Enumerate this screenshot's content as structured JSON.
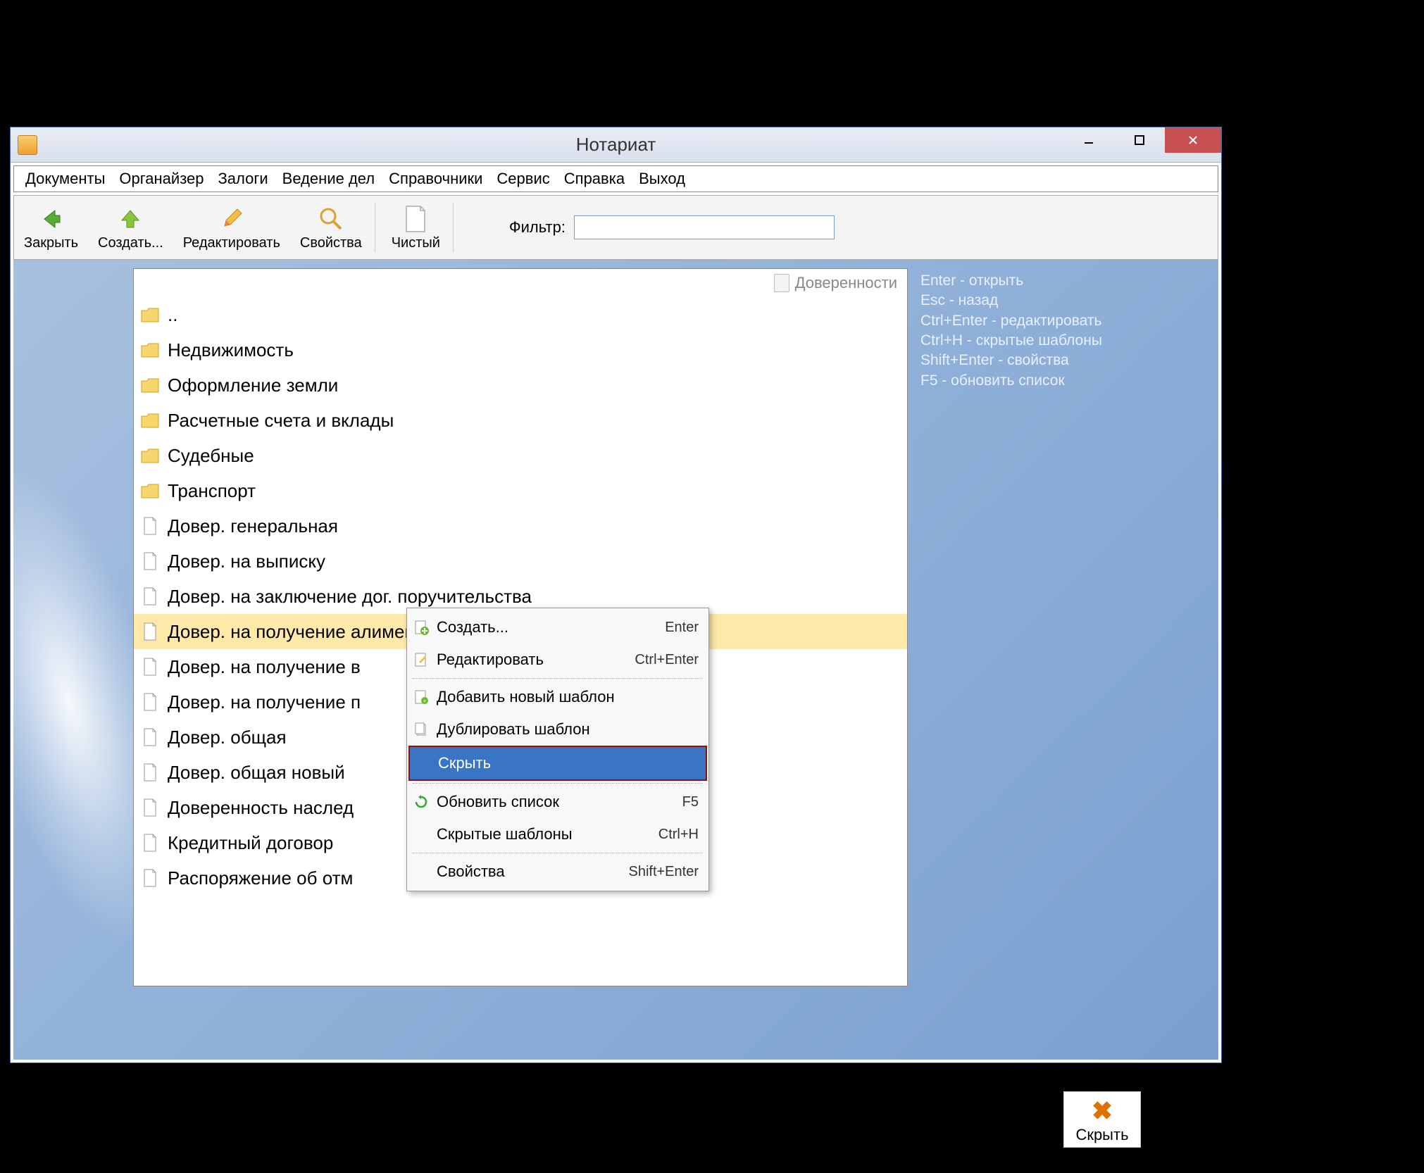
{
  "window": {
    "title": "Нотариат"
  },
  "menubar": [
    "Документы",
    "Органайзер",
    "Залоги",
    "Ведение дел",
    "Справочники",
    "Сервис",
    "Справка",
    "Выход"
  ],
  "toolbar": {
    "close": "Закрыть",
    "create": "Создать...",
    "edit": "Редактировать",
    "properties": "Свойства",
    "clean": "Чистый",
    "filter_label": "Фильтр:",
    "filter_value": ""
  },
  "breadcrumb": "Доверенности",
  "list": {
    "up": "..",
    "folders": [
      "Недвижимость",
      "Оформление земли",
      "Расчетные счета и вклады",
      "Судебные",
      "Транспорт"
    ],
    "docs": [
      "Довер. генеральная",
      "Довер. на выписку",
      "Довер. на заключение дог. поручительства",
      "Довер. на получение алиментов",
      "Довер. на получение в",
      "Довер. на получение п",
      "Довер. общая",
      "Довер. общая новый",
      "Доверенность наслед",
      "Кредитный договор",
      "Распоряжение об отм"
    ],
    "selected_index": 3
  },
  "hints": [
    "Enter - открыть",
    "Esc - назад",
    "Ctrl+Enter - редактировать",
    "Ctrl+H - скрытые шаблоны",
    "Shift+Enter - свойства",
    "F5 - обновить список"
  ],
  "context_menu": {
    "items": [
      {
        "label": "Создать...",
        "shortcut": "Enter",
        "icon": "plus"
      },
      {
        "label": "Редактировать",
        "shortcut": "Ctrl+Enter",
        "icon": "edit"
      },
      {
        "sep": true
      },
      {
        "label": "Добавить новый шаблон",
        "shortcut": "",
        "icon": "add-doc"
      },
      {
        "label": "Дублировать шаблон",
        "shortcut": "",
        "icon": "dup-doc"
      },
      {
        "label": "Скрыть",
        "shortcut": "",
        "icon": "",
        "highlighted": true
      },
      {
        "sep": true
      },
      {
        "label": "Обновить список",
        "shortcut": "F5",
        "icon": "refresh"
      },
      {
        "label": "Скрытые шаблоны",
        "shortcut": "Ctrl+H",
        "icon": ""
      },
      {
        "sep": true
      },
      {
        "label": "Свойства",
        "shortcut": "Shift+Enter",
        "icon": ""
      }
    ]
  },
  "tooltip": {
    "label": "Скрыть"
  }
}
